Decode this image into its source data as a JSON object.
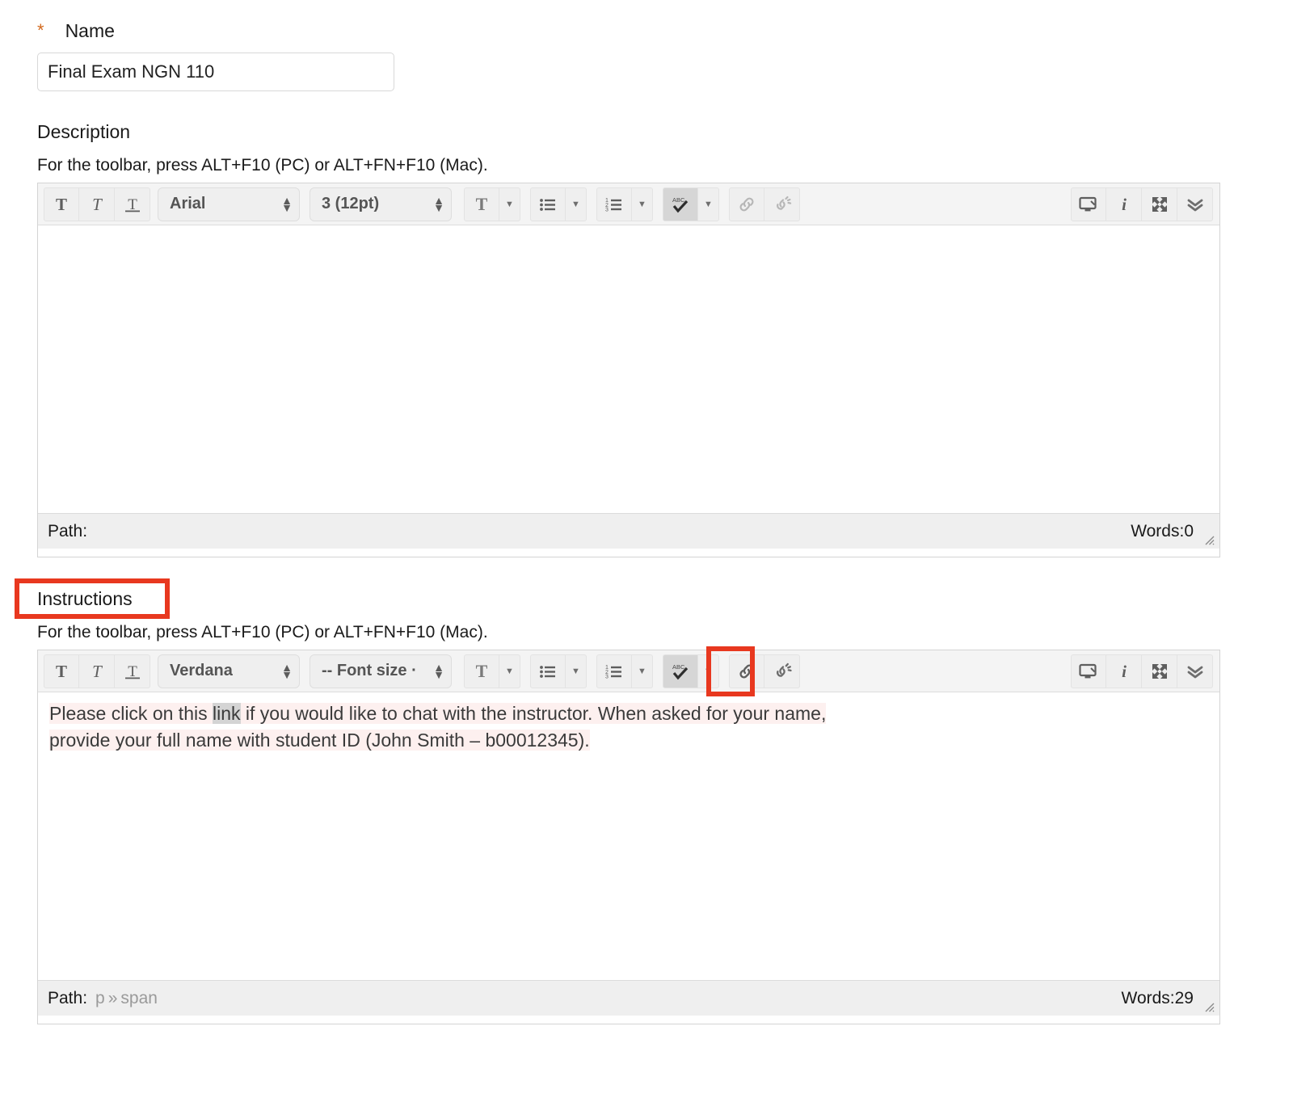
{
  "form": {
    "name": {
      "label": "Name",
      "required_marker": "*",
      "value": "Final Exam NGN 110"
    },
    "description": {
      "label": "Description",
      "hint": "For the toolbar, press ALT+F10 (PC) or ALT+FN+F10 (Mac).",
      "content": "",
      "status": {
        "path_label": "Path:",
        "path_value": "",
        "words": "Words:0"
      },
      "toolbar": {
        "font_family": "Arial",
        "font_size": "3 (12pt)",
        "buttons": [
          "bold-button",
          "italic-button",
          "underline-button",
          "text-color-button",
          "bullet-list-button",
          "numbered-list-button",
          "spellcheck-button",
          "insert-link-button",
          "remove-link-button",
          "preview-button",
          "info-button",
          "fullscreen-button",
          "more-toolbars-button"
        ]
      }
    },
    "instructions": {
      "label": "Instructions",
      "hint": "For the toolbar, press ALT+F10 (PC) or ALT+FN+F10 (Mac).",
      "content_line1_a": "Please click on this ",
      "content_link_word": "link",
      "content_line1_b": " if you would like to chat with the instructor. When asked for your name,",
      "content_line2": "provide your full name with student ID (John Smith – b00012345).",
      "status": {
        "path_label": "Path:",
        "path_p": "p",
        "path_sep": "»",
        "path_span": "span",
        "words": "Words:29"
      },
      "toolbar": {
        "font_family": "Verdana",
        "font_size": "-- Font size ·",
        "buttons": [
          "bold-button",
          "italic-button",
          "underline-button",
          "text-color-button",
          "bullet-list-button",
          "numbered-list-button",
          "spellcheck-button",
          "insert-link-button",
          "remove-link-button",
          "preview-button",
          "info-button",
          "fullscreen-button",
          "more-toolbars-button"
        ]
      }
    }
  },
  "annotations": {
    "instructions_label_highlight": "red-box",
    "insert_link_highlight": "red-box",
    "color": "#e8381f"
  },
  "colors": {
    "required_star": "#d2691e",
    "toolbar_bg": "#f4f4f4",
    "annotation": "#e8381f",
    "text_highlight": "#fdf0ef"
  }
}
